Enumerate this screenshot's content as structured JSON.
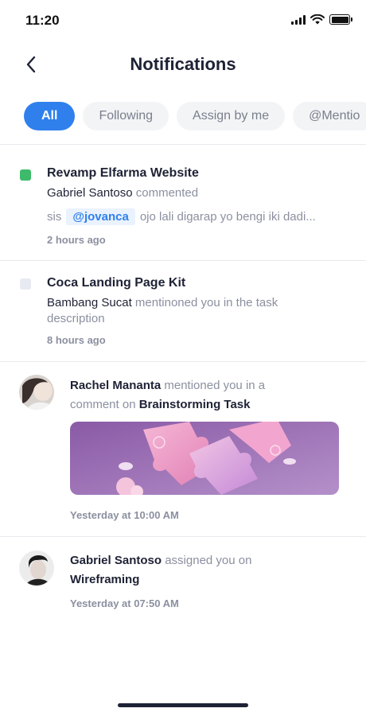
{
  "status_bar": {
    "time": "11:20"
  },
  "header": {
    "title": "Notifications"
  },
  "tabs": [
    {
      "label": "All",
      "active": true
    },
    {
      "label": "Following",
      "active": false
    },
    {
      "label": "Assign by me",
      "active": false
    },
    {
      "label": "@Mentio",
      "active": false
    }
  ],
  "notifications": [
    {
      "title": "Revamp Elfarma Website",
      "actor": "Gabriel Santoso",
      "action": "commented",
      "comment_prefix": "sis",
      "mention": "@jovanca",
      "comment_suffix": "ojo lali digarap yo bengi iki dadi...",
      "time": "2 hours ago",
      "indicator_color": "#3dbb6a"
    },
    {
      "title": "Coca Landing Page Kit",
      "actor": "Bambang Sucat",
      "action_line1": "mentinoned you in the task",
      "action_line2": "description",
      "time": "8 hours ago",
      "indicator_color": "#e7eaf0"
    },
    {
      "actor": "Rachel Mananta",
      "action_line1": "mentioned you in a",
      "action_line2": "comment on",
      "target": "Brainstorming Task",
      "time": "Yesterday at 10:00 AM"
    },
    {
      "actor": "Gabriel Santoso",
      "action_line1": "assigned you on",
      "target": "Wireframing",
      "time": "Yesterday at 07:50 AM"
    }
  ],
  "colors": {
    "accent": "#2f80ed",
    "text_dark": "#1e2235",
    "text_muted": "#8b90a0"
  }
}
